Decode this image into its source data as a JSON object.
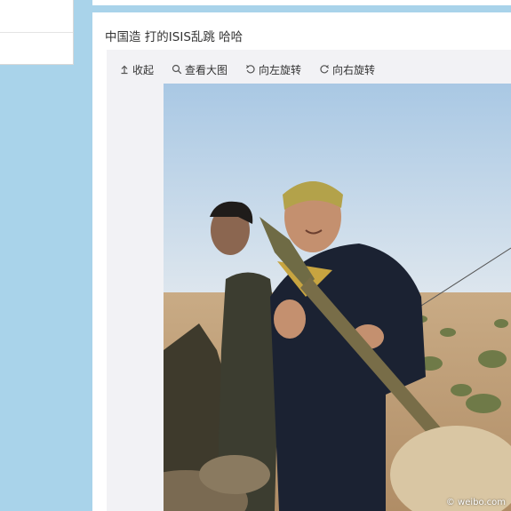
{
  "post": {
    "text": "中国造 打的ISIS乱跳 哈哈"
  },
  "toolbar": {
    "collapse_label": "收起",
    "view_large_label": "查看大图",
    "rotate_left_label": "向左旋转",
    "rotate_right_label": "向右旋转"
  },
  "photo": {
    "watermark": "© weibo.com"
  },
  "colors": {
    "page_background": "#a9d3ea",
    "card_background": "#ffffff",
    "media_background": "#f2f2f5"
  }
}
